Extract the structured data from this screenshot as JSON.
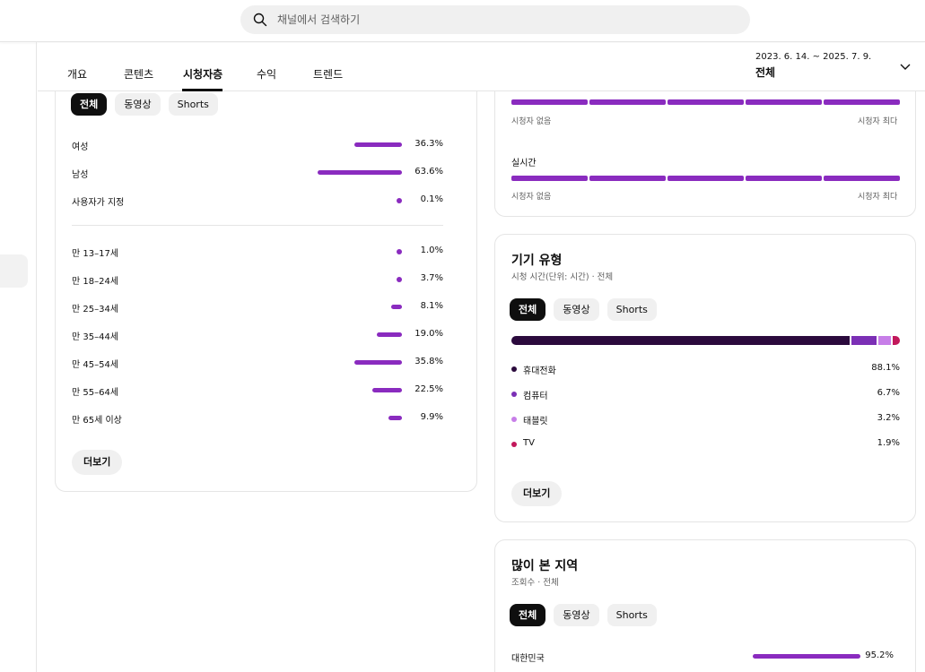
{
  "search": {
    "placeholder": "채널에서 검색하기"
  },
  "tabs": [
    {
      "label": "개요"
    },
    {
      "label": "콘텐츠"
    },
    {
      "label": "시청자층"
    },
    {
      "label": "수익"
    },
    {
      "label": "트렌드"
    }
  ],
  "active_tab": "시청자층",
  "date_range": {
    "range": "2023. 6. 14. ~ 2025. 7. 9.",
    "value": "전체"
  },
  "filters": {
    "all": "전체",
    "video": "동영상",
    "shorts": "Shorts"
  },
  "demographics": {
    "gender": [
      {
        "label": "여성",
        "value": "36.3%",
        "pct": 36.3
      },
      {
        "label": "남성",
        "value": "63.6%",
        "pct": 63.6
      },
      {
        "label": "사용자가 지정",
        "value": "0.1%",
        "pct": 0.1
      }
    ],
    "age": [
      {
        "label": "만 13–17세",
        "value": "1.0%",
        "pct": 1.0
      },
      {
        "label": "만 18–24세",
        "value": "3.7%",
        "pct": 3.7
      },
      {
        "label": "만 25–34세",
        "value": "8.1%",
        "pct": 8.1
      },
      {
        "label": "만 35–44세",
        "value": "19.0%",
        "pct": 19.0
      },
      {
        "label": "만 45–54세",
        "value": "35.8%",
        "pct": 35.8
      },
      {
        "label": "만 55–64세",
        "value": "22.5%",
        "pct": 22.5
      },
      {
        "label": "만 65세 이상",
        "value": "9.9%",
        "pct": 9.9
      }
    ],
    "more_label": "더보기"
  },
  "viewer_activity": {
    "min_label": "시청자 없음",
    "max_label": "시청자 최다",
    "realtime_label": "실시간"
  },
  "device": {
    "title": "기기 유형",
    "subtitle": "시청 시간(단위: 시간) · 전체",
    "items": [
      {
        "label": "휴대전화",
        "value": "88.1%",
        "pct": 88.1,
        "color": "#2b0a3d"
      },
      {
        "label": "컴퓨터",
        "value": "6.7%",
        "pct": 6.7,
        "color": "#7b2fb5"
      },
      {
        "label": "태블릿",
        "value": "3.2%",
        "pct": 3.2,
        "color": "#c77ee8"
      },
      {
        "label": "TV",
        "value": "1.9%",
        "pct": 1.9,
        "color": "#c2185b"
      }
    ],
    "more_label": "더보기"
  },
  "geography": {
    "title": "많이 본 지역",
    "subtitle": "조회수 · 전체",
    "items": [
      {
        "label": "대한민국",
        "value": "95.2%",
        "pct": 95.2
      }
    ]
  },
  "colors": {
    "accent": "#8a2bbf",
    "chip_active": "#0f0f0f",
    "chip_bg": "#f0f0f0"
  }
}
